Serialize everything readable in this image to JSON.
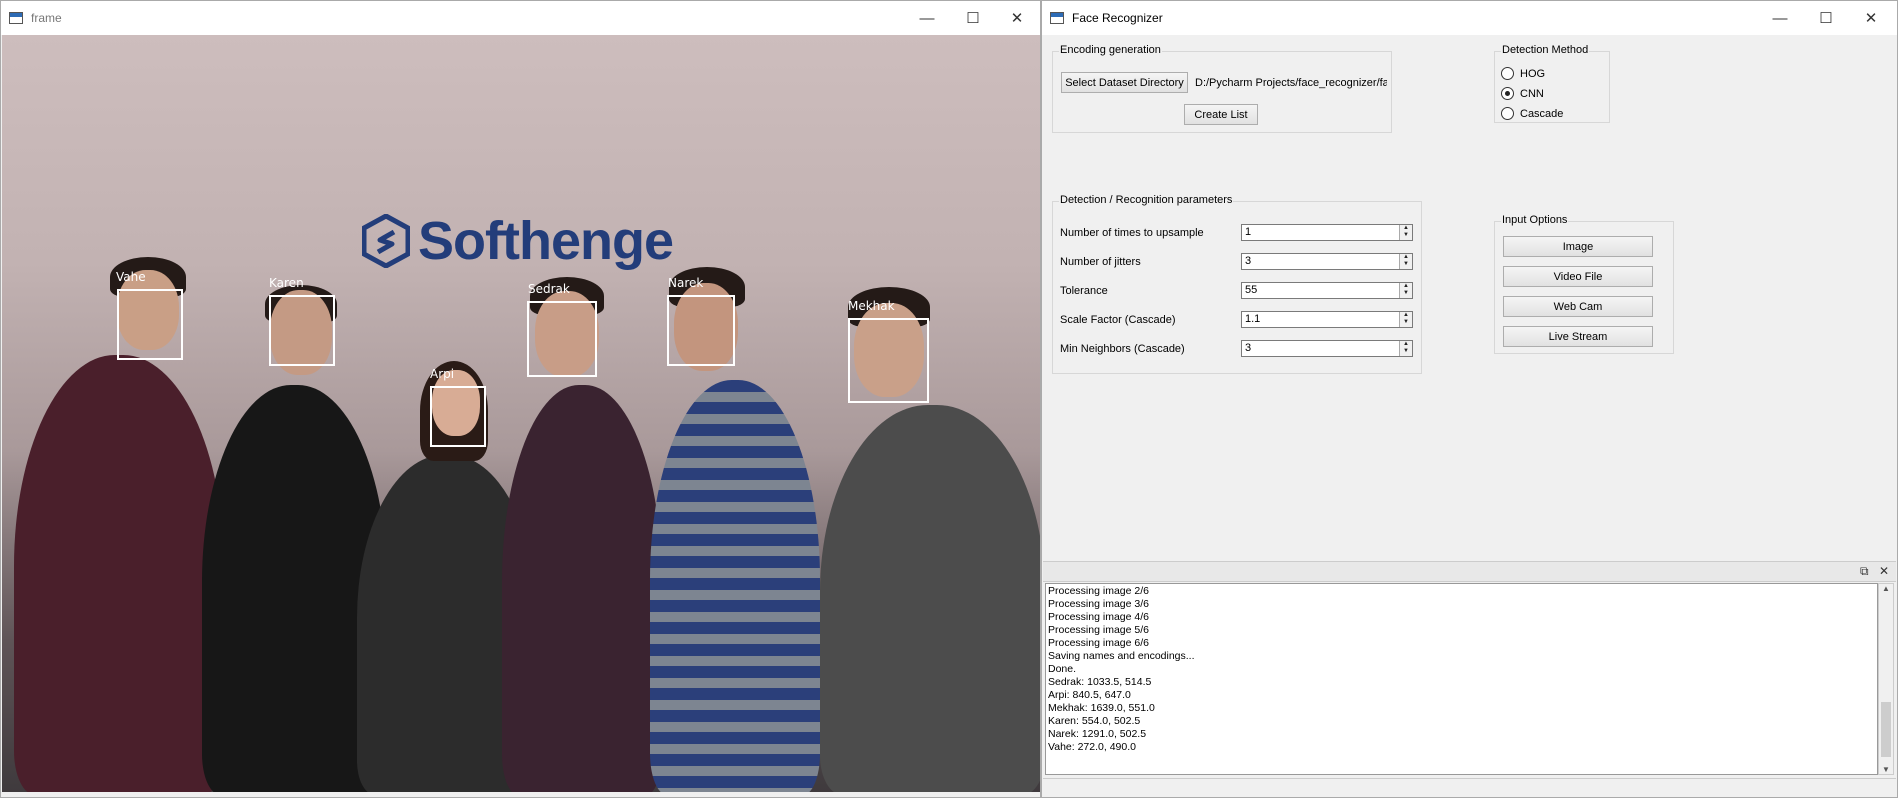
{
  "frame_window": {
    "title": "frame",
    "logo_text": "Softhenge",
    "faces": [
      {
        "name": "Vahe"
      },
      {
        "name": "Karen"
      },
      {
        "name": "Arpi"
      },
      {
        "name": "Sedrak"
      },
      {
        "name": "Narek"
      },
      {
        "name": "Mekhak"
      }
    ]
  },
  "app_window": {
    "title": "Face Recognizer",
    "encoding_group": {
      "title": "Encoding generation",
      "select_button": "Select Dataset Directory",
      "path": "D:/Pycharm Projects/face_recognizer/fa",
      "create_button": "Create List"
    },
    "detection_group": {
      "title": "Detection Method",
      "options": [
        {
          "label": "HOG",
          "checked": false
        },
        {
          "label": "CNN",
          "checked": true
        },
        {
          "label": "Cascade",
          "checked": false
        }
      ]
    },
    "params_group": {
      "title": "Detection / Recognition parameters",
      "rows": [
        {
          "label": "Number of times to upsample",
          "value": "1"
        },
        {
          "label": "Number of jitters",
          "value": "3"
        },
        {
          "label": "Tolerance",
          "value": "55"
        },
        {
          "label": "Scale Factor (Cascade)",
          "value": "1.1"
        },
        {
          "label": "Min Neighbors (Cascade)",
          "value": "3"
        }
      ]
    },
    "input_group": {
      "title": "Input Options",
      "buttons": [
        "Image",
        "Video File",
        "Web Cam",
        "Live Stream"
      ]
    },
    "log_lines": [
      "Processing image 2/6",
      "Processing image 3/6",
      "Processing image 4/6",
      "Processing image 5/6",
      "Processing image 6/6",
      "Saving names and encodings...",
      "Done.",
      "Sedrak: 1033.5, 514.5",
      "Arpi: 840.5, 647.0",
      "Mekhak: 1639.0, 551.0",
      "Karen: 554.0, 502.5",
      "Narek: 1291.0, 502.5",
      "Vahe: 272.0, 490.0"
    ]
  },
  "colors": {
    "logo_blue": "#233d7a",
    "face_box": "#ffffff",
    "window_bg": "#f0f0f0"
  }
}
